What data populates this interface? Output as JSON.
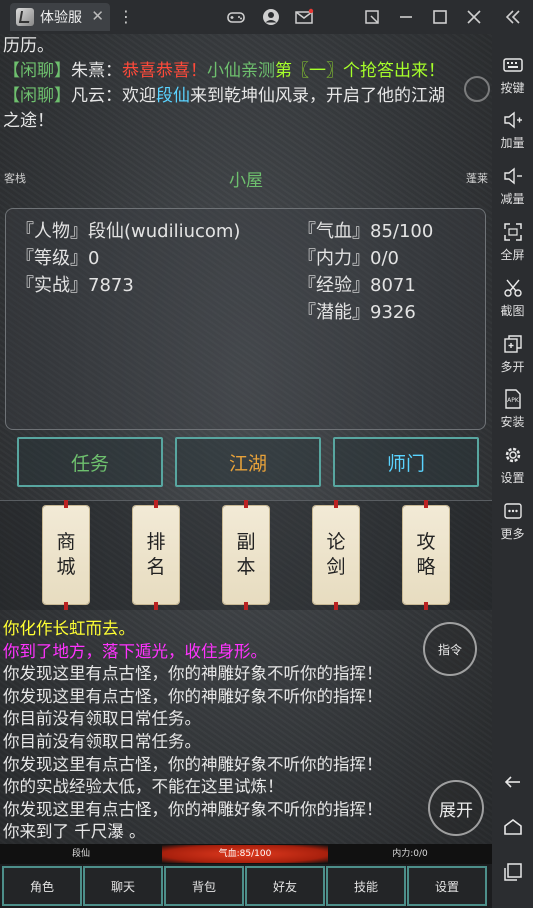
{
  "titlebar": {
    "tab_title": "体验服",
    "icons": [
      "gamepad-icon",
      "user-icon",
      "mail-icon",
      "pin-icon",
      "minimize-icon",
      "maximize-icon",
      "close-icon",
      "collapse-icon"
    ]
  },
  "chat": [
    {
      "plain": "历历。"
    },
    {
      "channel": "【闲聊】",
      "speaker": "朱熹：",
      "part1": "恭喜恭喜！",
      "part2": "小仙亲测",
      "part3": "第〖一〗个抢答出来！"
    },
    {
      "channel": "【闲聊】",
      "speaker": "凡云：",
      "pre": "欢迎",
      "name": "段仙",
      "post": "来到乾坤仙风录，开启了他的江湖"
    },
    {
      "plain": "之途！"
    }
  ],
  "room": {
    "left_tag": "客栈",
    "title": "小屋",
    "right_tag": "蓬莱"
  },
  "stats": {
    "person": "『人物』段仙(wudiliucom)",
    "level": "『等级』0",
    "combat": "『实战』7873",
    "hp": "『气血』85/100",
    "mp": "『内力』0/0",
    "exp": "『经验』8071",
    "potential": "『潜能』9326"
  },
  "tabs": {
    "task": "任务",
    "jianghu": "江湖",
    "shimen": "师门"
  },
  "scrolls": [
    {
      "l1": "商",
      "l2": "城"
    },
    {
      "l1": "排",
      "l2": "名"
    },
    {
      "l1": "副",
      "l2": "本"
    },
    {
      "l1": "论",
      "l2": "剑"
    },
    {
      "l1": "攻",
      "l2": "略"
    }
  ],
  "log": [
    "你化作长虹而去。",
    "你到了地方，落下遁光，收住身形。",
    "你发现这里有点古怪，你的神雕好象不听你的指挥！",
    "你发现这里有点古怪，你的神雕好象不听你的指挥！",
    "你目前没有领取日常任务。",
    "你目前没有领取日常任务。",
    "你发现这里有点古怪，你的神雕好象不听你的指挥！",
    "你的实战经验太低，不能在这里试炼！",
    "你发现这里有点古怪，你的神雕好象不听你的指挥！",
    "你来到了 千尺瀑 。"
  ],
  "buttons": {
    "command": "指令",
    "expand": "展开"
  },
  "statusbar": {
    "name": "段仙",
    "hp": "气血:85/100",
    "mp": "内力:0/0"
  },
  "bottom_nav": [
    "角色",
    "聊天",
    "背包",
    "好友",
    "技能",
    "设置"
  ],
  "sidebar": [
    {
      "icon": "keyboard-icon",
      "label": "按键"
    },
    {
      "icon": "volume-up-icon",
      "label": "加量"
    },
    {
      "icon": "volume-down-icon",
      "label": "减量"
    },
    {
      "icon": "fullscreen-icon",
      "label": "全屏"
    },
    {
      "icon": "scissors-icon",
      "label": "截图"
    },
    {
      "icon": "multi-open-icon",
      "label": "多开"
    },
    {
      "icon": "apk-icon",
      "label": "安装"
    },
    {
      "icon": "gear-icon",
      "label": "设置"
    },
    {
      "icon": "more-icon",
      "label": "更多"
    }
  ],
  "colors": {
    "green": "#6ec06e",
    "red": "#ff4a3a",
    "yellow": "#ffff33",
    "magenta": "#ff33ff",
    "cyan": "#58a6a0",
    "orange": "#e8a23a"
  }
}
